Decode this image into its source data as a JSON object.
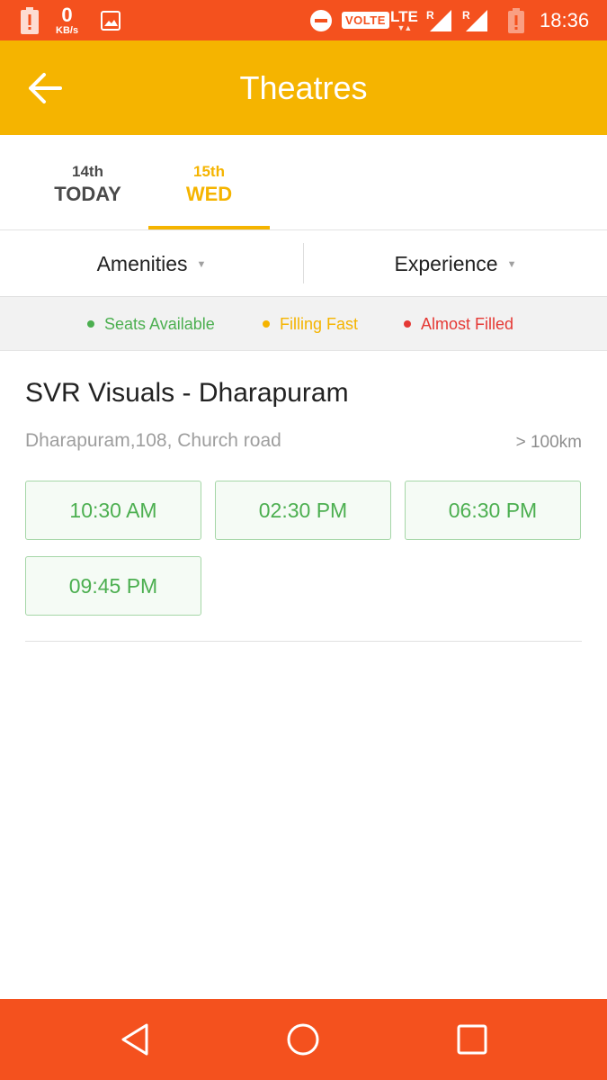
{
  "status_bar": {
    "net_speed_value": "0",
    "net_speed_unit": "KB/s",
    "volte_label": "VOLTE",
    "lte_label": "LTE",
    "roaming_1": "R",
    "roaming_2": "R",
    "time": "18:36",
    "icons": [
      "battery-alert-icon",
      "gallery-icon",
      "do-not-disturb-icon",
      "signal-icon",
      "signal-icon",
      "battery-alert-icon"
    ]
  },
  "app_bar": {
    "title": "Theatres",
    "back_icon": "arrow-left-icon",
    "background": "#f5b400"
  },
  "date_tabs": [
    {
      "day": "14th",
      "label": "TODAY",
      "selected": false
    },
    {
      "day": "15th",
      "label": "WED",
      "selected": true
    }
  ],
  "filters": {
    "amenities": "Amenities",
    "experience": "Experience"
  },
  "legend": {
    "available": "Seats Available",
    "filling": "Filling Fast",
    "filled": "Almost Filled",
    "colors": {
      "available": "#4caf50",
      "filling": "#f5b400",
      "filled": "#e53935"
    }
  },
  "theatres": [
    {
      "name": "SVR Visuals - Dharapuram",
      "address": "Dharapuram,108, Church road",
      "distance": "> 100km",
      "showtimes": [
        "10:30 AM",
        "02:30 PM",
        "06:30 PM",
        "09:45 PM"
      ]
    }
  ],
  "colors": {
    "status_bar": "#f4511e",
    "accent": "#f5b400",
    "showtime_green": "#4caf50"
  }
}
